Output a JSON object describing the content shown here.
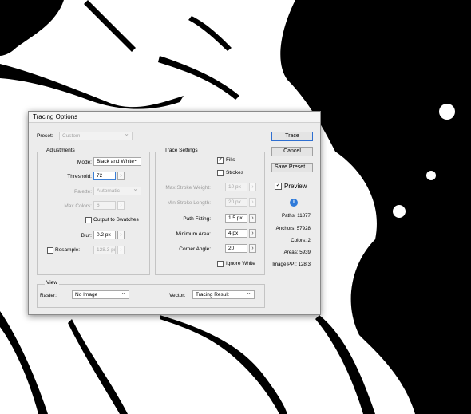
{
  "dialog": {
    "title": "Tracing Options"
  },
  "preset": {
    "label": "Preset:",
    "value": "Custom"
  },
  "adjustments": {
    "title": "Adjustments",
    "mode": {
      "label": "Mode:",
      "value": "Black and White"
    },
    "threshold": {
      "label": "Threshold:",
      "value": "72"
    },
    "palette": {
      "label": "Palette:",
      "value": "Automatic"
    },
    "max_colors": {
      "label": "Max Colors:",
      "value": "6"
    },
    "output_to_swatches": {
      "label": "Output to Swatches",
      "checked": false
    },
    "blur": {
      "label": "Blur:",
      "value": "0.2 px"
    },
    "resample": {
      "label": "Resample:",
      "value": "128.3 px",
      "checked": false
    }
  },
  "trace_settings": {
    "title": "Trace Settings",
    "fills": {
      "label": "Fills",
      "checked": true
    },
    "strokes": {
      "label": "Strokes",
      "checked": false
    },
    "max_stroke_weight": {
      "label": "Max Stroke Weight:",
      "value": "10 px"
    },
    "min_stroke_length": {
      "label": "Min Stroke Length:",
      "value": "20 px"
    },
    "path_fitting": {
      "label": "Path Fitting:",
      "value": "1.5 px"
    },
    "minimum_area": {
      "label": "Minimum Area:",
      "value": "4 px"
    },
    "corner_angle": {
      "label": "Corner Angle:",
      "value": "20"
    },
    "ignore_white": {
      "label": "Ignore White",
      "checked": false
    }
  },
  "view": {
    "title": "View",
    "raster": {
      "label": "Raster:",
      "value": "No Image"
    },
    "vector": {
      "label": "Vector:",
      "value": "Tracing Result"
    }
  },
  "buttons": {
    "trace": "Trace",
    "cancel": "Cancel",
    "save_preset": "Save Preset..."
  },
  "preview": {
    "label": "Preview",
    "checked": true
  },
  "stats": {
    "paths": "Paths: 11877",
    "anchors": "Anchors: 57928",
    "colors": "Colors: 2",
    "areas": "Areas: 5939",
    "image_ppi": "Image PPI: 128.3"
  },
  "icons": {
    "checkmark": "check-icon",
    "info": "info-icon",
    "dropdown": "chevron-down-icon",
    "stepper": "arrow-right-icon"
  }
}
